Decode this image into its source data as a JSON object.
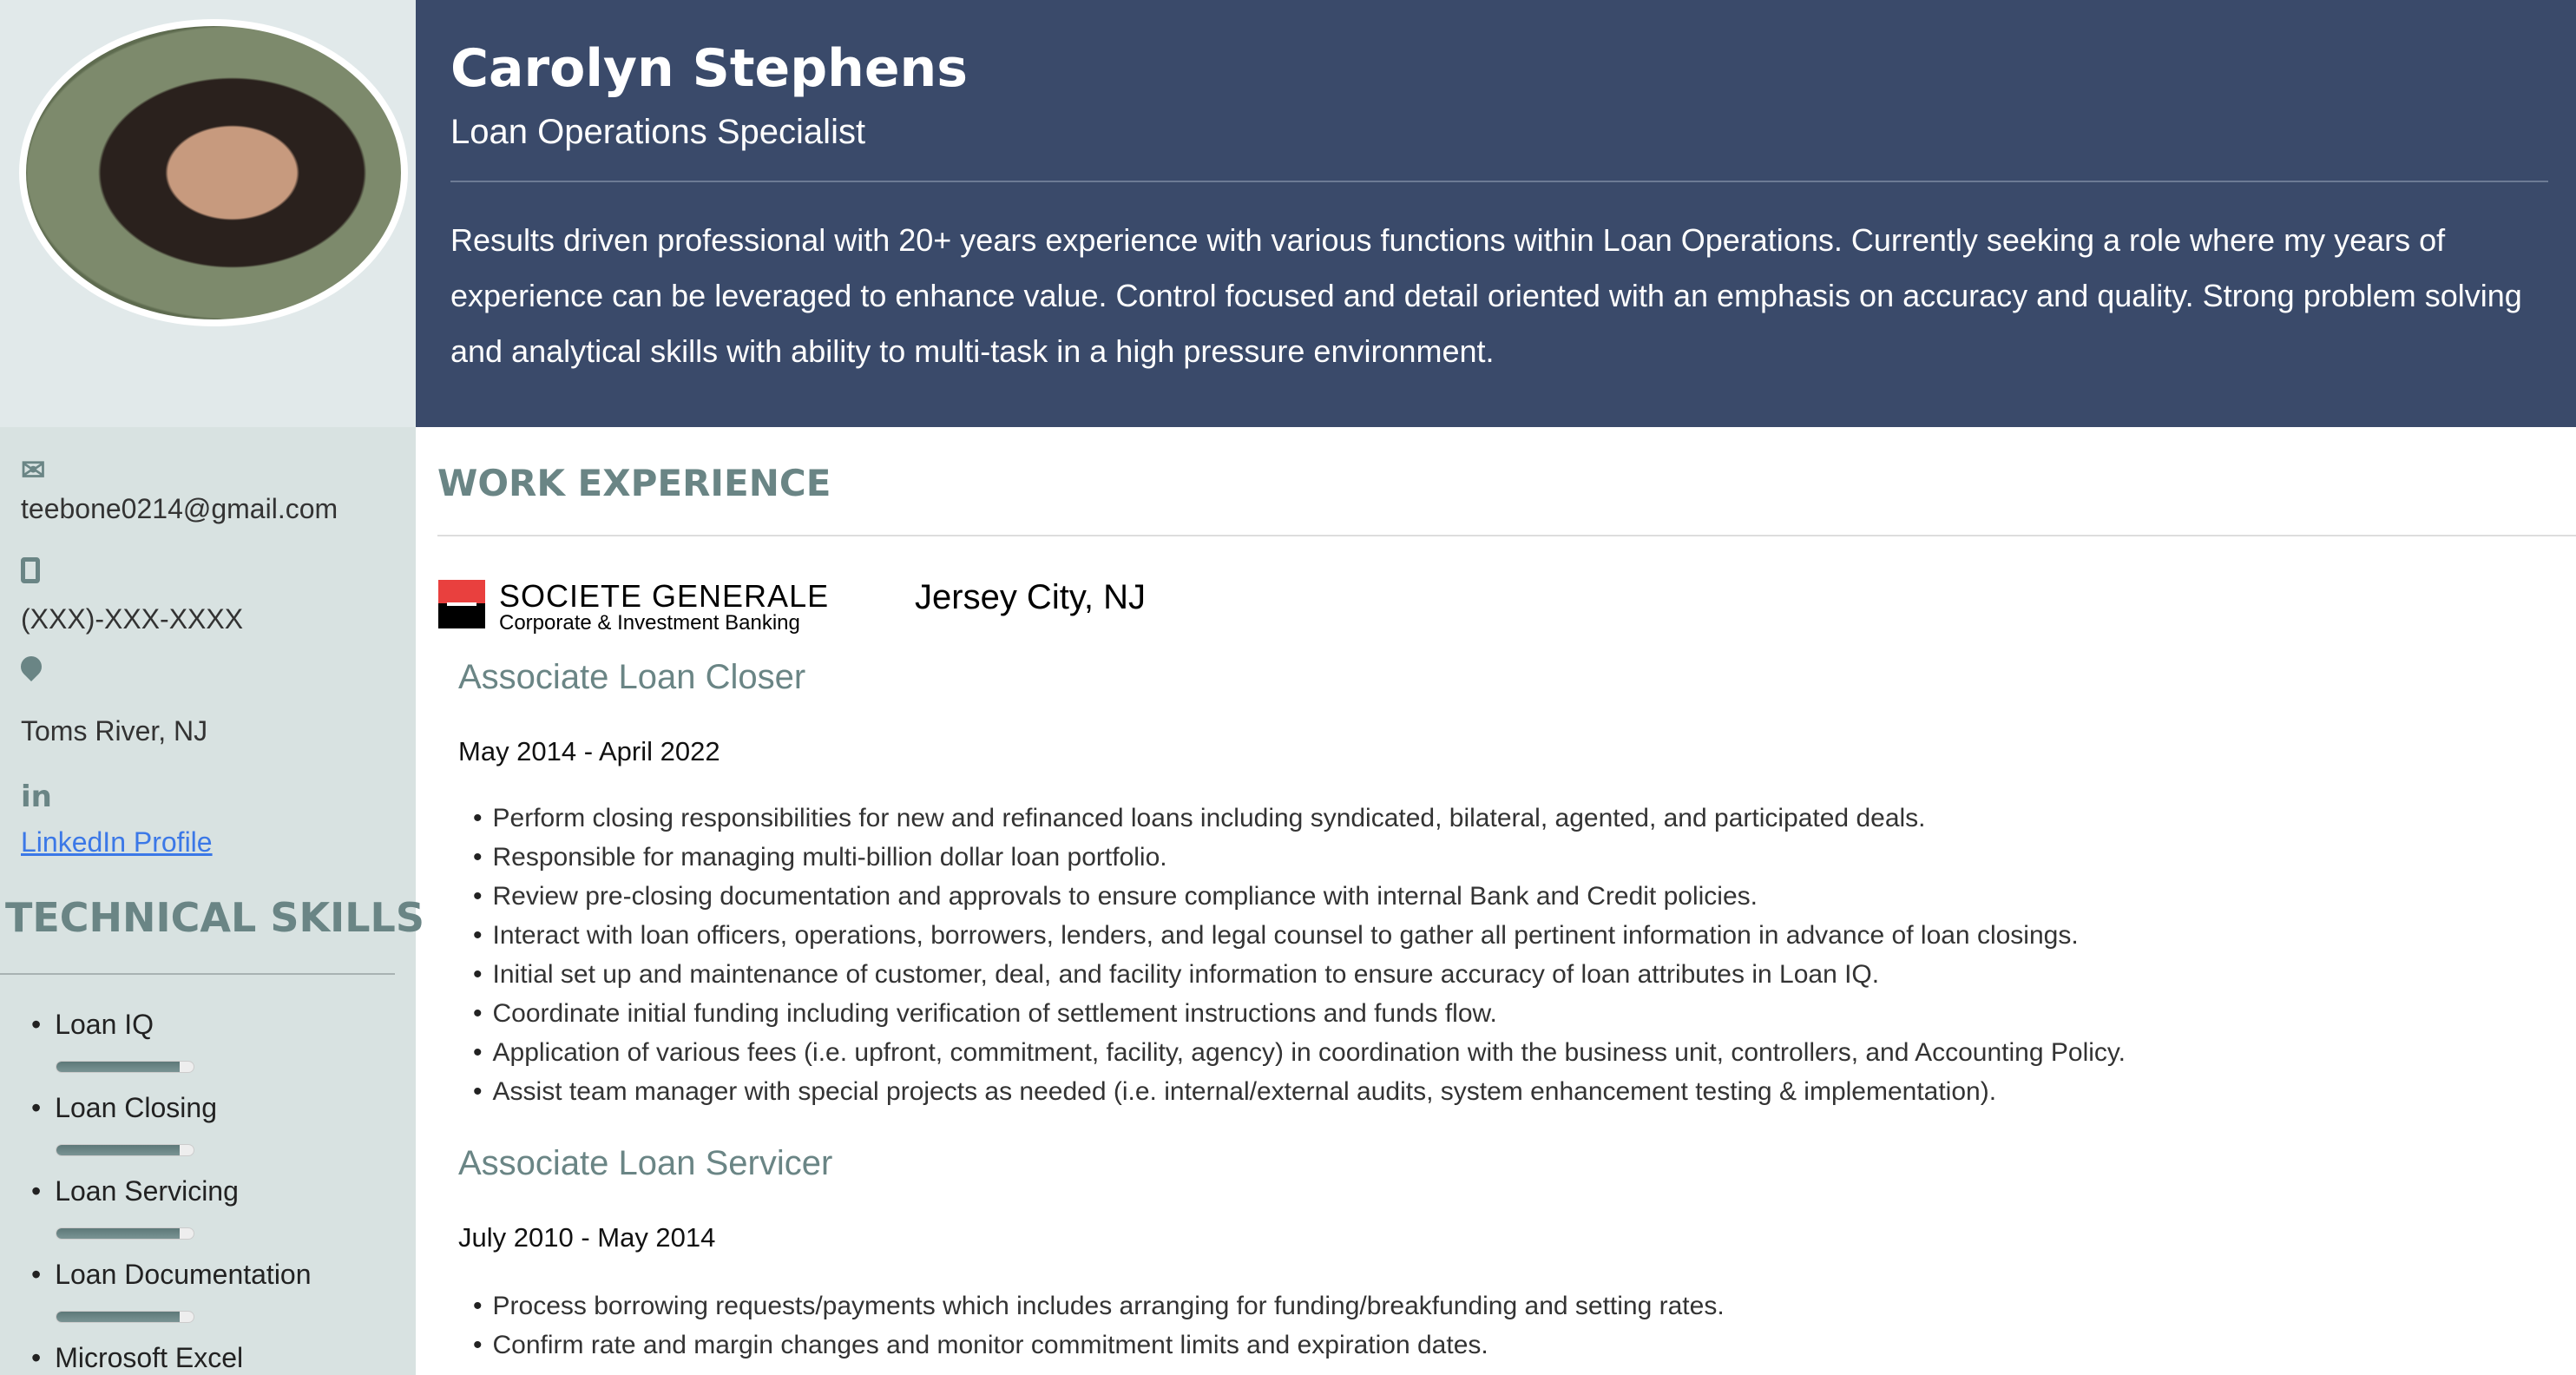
{
  "profile": {
    "name": "Carolyn Stephens",
    "role": "Loan Operations Specialist",
    "summary": "Results driven professional with 20+ years experience with various functions within Loan Operations.   Currently seeking a role where my years of experience can be leveraged to enhance value.  Control focused and detail oriented with an emphasis on accuracy and quality.   Strong problem solving and analytical skills with ability to multi-task in a high pressure environment."
  },
  "contact": {
    "email": "teebone0214@gmail.com",
    "phone": "(XXX)-XXX-XXXX",
    "location": "Toms River, NJ",
    "linkedin": "LinkedIn Profile",
    "icons": [
      "envelope-icon",
      "mobile-phone-icon",
      "map-marker-icon",
      "linkedin-icon"
    ]
  },
  "skills": {
    "heading": "TECHNICAL SKILLS",
    "items": [
      {
        "label": "Loan IQ",
        "level_pct": 90
      },
      {
        "label": "Loan Closing",
        "level_pct": 90
      },
      {
        "label": "Loan Servicing",
        "level_pct": 90
      },
      {
        "label": "Loan Documentation",
        "level_pct": 90
      },
      {
        "label": "Microsoft Excel"
      }
    ]
  },
  "work": {
    "heading": "WORK EXPERIENCE",
    "company_logo": {
      "name": "SOCIETE GENERALE",
      "tagline": "Corporate & Investment Banking",
      "colors": [
        "#e9403e",
        "#000000"
      ]
    },
    "city": "Jersey City, NJ",
    "jobs": [
      {
        "title": "Associate Loan Closer",
        "dates": "May 2014 - April 2022",
        "bullets": [
          "Perform closing responsibilities for new and refinanced loans including syndicated, bilateral, agented, and participated deals.",
          "Responsible for managing multi-billion dollar loan portfolio.",
          "Review pre-closing documentation and approvals to ensure compliance with internal Bank and Credit policies.",
          "Interact with loan officers, operations, borrowers, lenders, and legal counsel to gather all pertinent information in advance of loan closings.",
          "Initial set up and maintenance of customer, deal, and facility information to ensure accuracy of loan attributes in Loan IQ.",
          "Coordinate initial funding including verification of settlement instructions and funds flow.",
          "Application of various fees (i.e. upfront, commitment, facility, agency) in coordination with the business unit, controllers, and Accounting Policy.",
          "Assist team manager with special projects as needed (i.e. internal/external audits, system enhancement testing & implementation)."
        ]
      },
      {
        "title": "Associate Loan Servicer",
        "dates": "July 2010 - May 2014",
        "bullets": [
          "Process borrowing requests/payments which includes arranging for funding/breakfunding and setting rates.",
          "Confirm rate and margin changes and monitor commitment limits and expiration dates."
        ]
      }
    ]
  },
  "colors": {
    "header_bg": "#3a4a6a",
    "sidebar_bg": "#d8e2e1",
    "accent": "#6a8585",
    "link": "#3b78e7"
  }
}
